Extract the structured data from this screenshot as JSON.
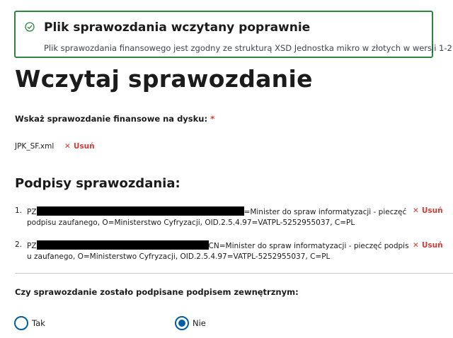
{
  "alert": {
    "title": "Plik sprawozdania wczytany poprawnie",
    "message": "Plik sprawozdania finansowego jest zgodny ze strukturą XSD Jednostka mikro w złotych w wersji 1-2 .",
    "icon": "check-circle-icon",
    "color": "#2e8540"
  },
  "page_title": "Wczytaj sprawozdanie",
  "upload": {
    "label": "Wskaż sprawozdanie finansowe na dysku:",
    "required_mark": "*",
    "file_name": "JPK_SF.xml",
    "remove_label": "Usuń"
  },
  "signatures": {
    "title": "Podpisy sprawozdania:",
    "remove_label": "Usuń",
    "items": [
      {
        "number": "1.",
        "prefix": "PZ",
        "line1_suffix": "=Minister do spraw informatyzacji - pieczęć",
        "line2": "podpisu zaufanego, O=Ministerstwo Cyfryzacji, OID.2.5.4.97=VATPL-5252955037, C=PL"
      },
      {
        "number": "2.",
        "prefix": "PZ",
        "line1_suffix": "CN=Minister do spraw informatyzacji - pieczęć podpis",
        "line2": "u zaufanego, O=Ministerstwo Cyfryzacji, OID.2.5.4.97=VATPL-5252955037, C=PL"
      }
    ]
  },
  "external_signature": {
    "question": "Czy sprawozdanie zostało podpisane podpisem zewnętrznym:",
    "options": [
      {
        "label": "Tak",
        "selected": false
      },
      {
        "label": "Nie",
        "selected": true
      }
    ]
  },
  "colors": {
    "success": "#2e8540",
    "danger": "#d83933",
    "primary": "#005ea2"
  }
}
